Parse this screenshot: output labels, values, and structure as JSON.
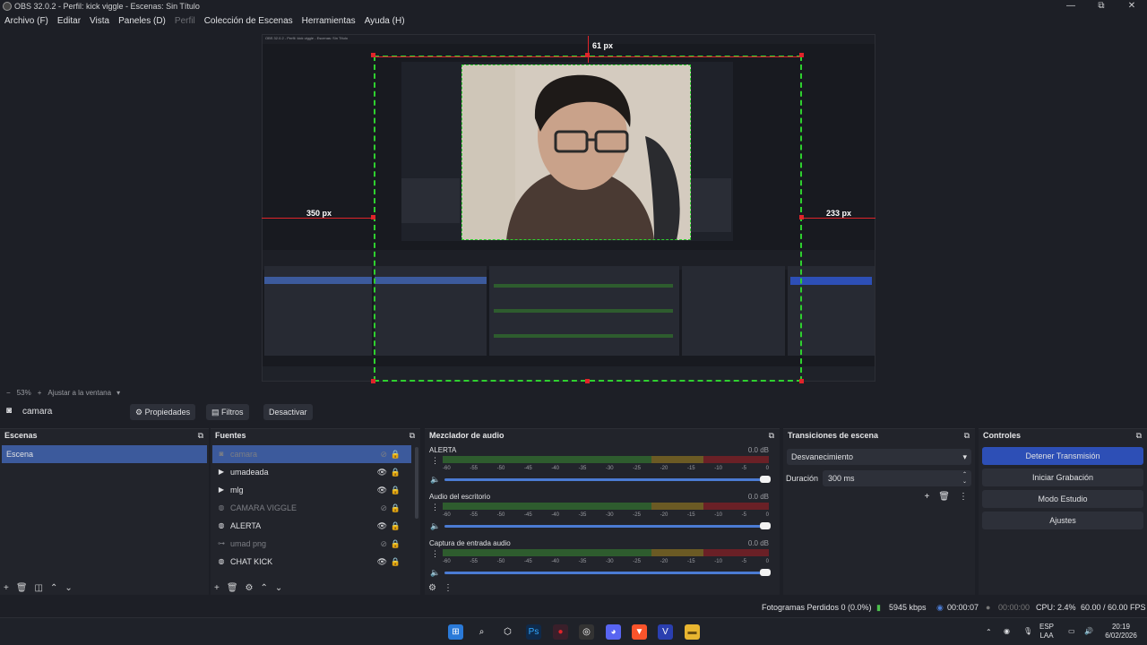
{
  "window": {
    "title": "OBS 32.0.2 - Perfil: kick viggle - Escenas: Sin Título",
    "min": "—",
    "max": "⧉",
    "close": "✕"
  },
  "menu": [
    "Archivo (F)",
    "Editar",
    "Vista",
    "Paneles (D)",
    "Perfil",
    "Colección de Escenas",
    "Herramientas",
    "Ayuda (H)"
  ],
  "preview": {
    "top_px": "61 px",
    "left_px": "350 px",
    "right_px": "233 px",
    "mini_title": "OBS 32.0.2 - Perfil: kick viggle - Escenas: Sin Título"
  },
  "zoom": {
    "minus": "−",
    "value": "53%",
    "plus": "+",
    "fit": "Ajustar a la ventana"
  },
  "source_toolbar": {
    "source": "camara",
    "properties": "Propiedades",
    "filters": "Filtros",
    "deactivate": "Desactivar"
  },
  "scenes": {
    "title": "Escenas",
    "items": [
      "Escena"
    ]
  },
  "sources": {
    "title": "Fuentes",
    "items": [
      {
        "name": "camara",
        "icon": "camera-icon",
        "visible": false,
        "dim": true
      },
      {
        "name": "umadeada",
        "icon": "play-icon",
        "visible": true,
        "dim": false
      },
      {
        "name": "mlg",
        "icon": "play-icon",
        "visible": true,
        "dim": false
      },
      {
        "name": "CAMARA VIGGLE",
        "icon": "browser-icon",
        "visible": false,
        "dim": true
      },
      {
        "name": "ALERTA",
        "icon": "browser-icon",
        "visible": true,
        "dim": false
      },
      {
        "name": "umad png",
        "icon": "link-icon",
        "visible": false,
        "dim": true
      },
      {
        "name": "CHAT KICK",
        "icon": "browser-icon",
        "visible": true,
        "dim": false
      }
    ]
  },
  "mixer": {
    "title": "Mezclador de audio",
    "scale": [
      "-60",
      "-55",
      "-50",
      "-45",
      "-40",
      "-35",
      "-30",
      "-25",
      "-20",
      "-15",
      "-10",
      "-5",
      "0"
    ],
    "channels": [
      {
        "name": "ALERTA",
        "db": "0.0 dB"
      },
      {
        "name": "Audio del escritorio",
        "db": "0.0 dB"
      },
      {
        "name": "Captura de entrada audio",
        "db": "0.0 dB"
      }
    ]
  },
  "transitions": {
    "title": "Transiciones de escena",
    "type": "Desvanecimiento",
    "duration_label": "Duración",
    "duration": "300 ms"
  },
  "controls": {
    "title": "Controles",
    "buttons": [
      "Detener Transmisión",
      "Iniciar Grabación",
      "Modo Estudio",
      "Ajustes"
    ]
  },
  "status": {
    "dropped": "Fotogramas Perdidos 0 (0.0%)",
    "kbps": "5945 kbps",
    "stream_time": "00:00:07",
    "rec_time": "00:00:00",
    "cpu": "CPU: 2.4%",
    "fps": "60.00 / 60.00 FPS"
  },
  "taskbar": {
    "lang1": "ESP",
    "lang2": "LAA",
    "time": "20:19",
    "date": "6/02/2026"
  }
}
